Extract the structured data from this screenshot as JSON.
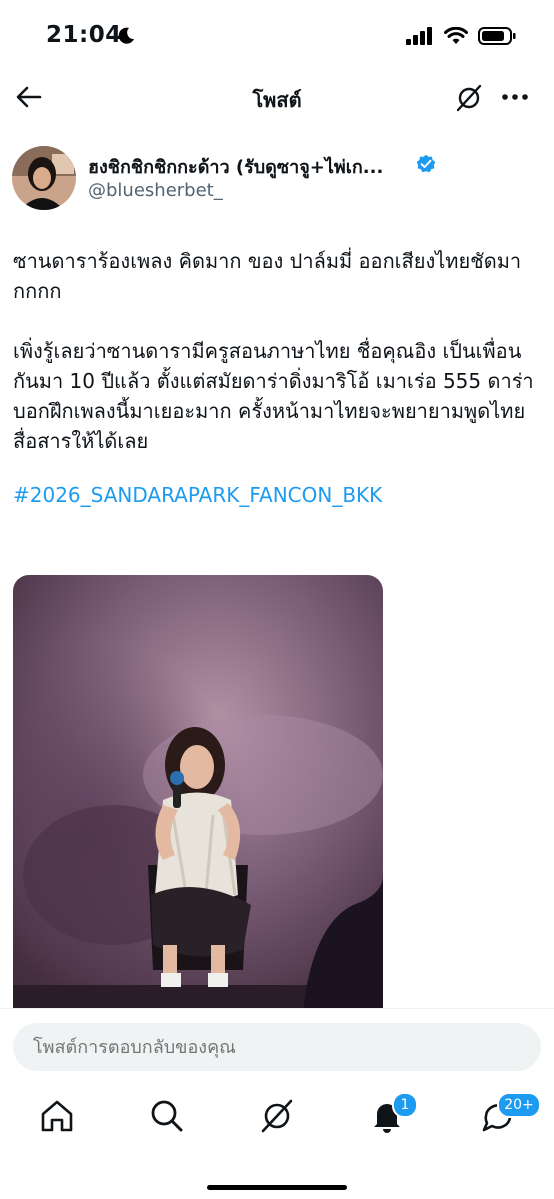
{
  "status_bar": {
    "time": "21:04"
  },
  "nav": {
    "title": "โพสต์"
  },
  "author": {
    "display_name": "ฮงชิกชิกชิกกะด้าว (รับดูซาจู+ไพ่เก...",
    "handle": "@bluesherbet_"
  },
  "tweet": {
    "paragraph1": "ซานดาราร้องเพลง คิดมาก ของ ปาล์มมี่ ออกเสียงไทยชัดมากกกก",
    "paragraph2": "เพิ่งรู้เลยว่าซานดารามีครูสอนภาษาไทย ชื่อคุณอิง เป็นเพื่อนกันมา 10 ปีแล้ว ตั้งแต่สมัยดาร่าดิ่งมาริโอ้ เมาเร่อ 555 ดาร่าบอกฝึกเพลงนี้มาเยอะมาก ครั้งหน้ามาไทยจะพยายามพูดไทยสื่อสารให้ได้เลย",
    "hashtag": "#2026_SANDARAPARK_FANCON_BKK"
  },
  "reply": {
    "placeholder": "โพสต์การตอบกลับของคุณ"
  },
  "tabbar": {
    "notifications_badge": "1",
    "messages_badge": "20+"
  },
  "colors": {
    "accent": "#1d9bf0",
    "text": "#0f1419",
    "muted": "#536471"
  }
}
